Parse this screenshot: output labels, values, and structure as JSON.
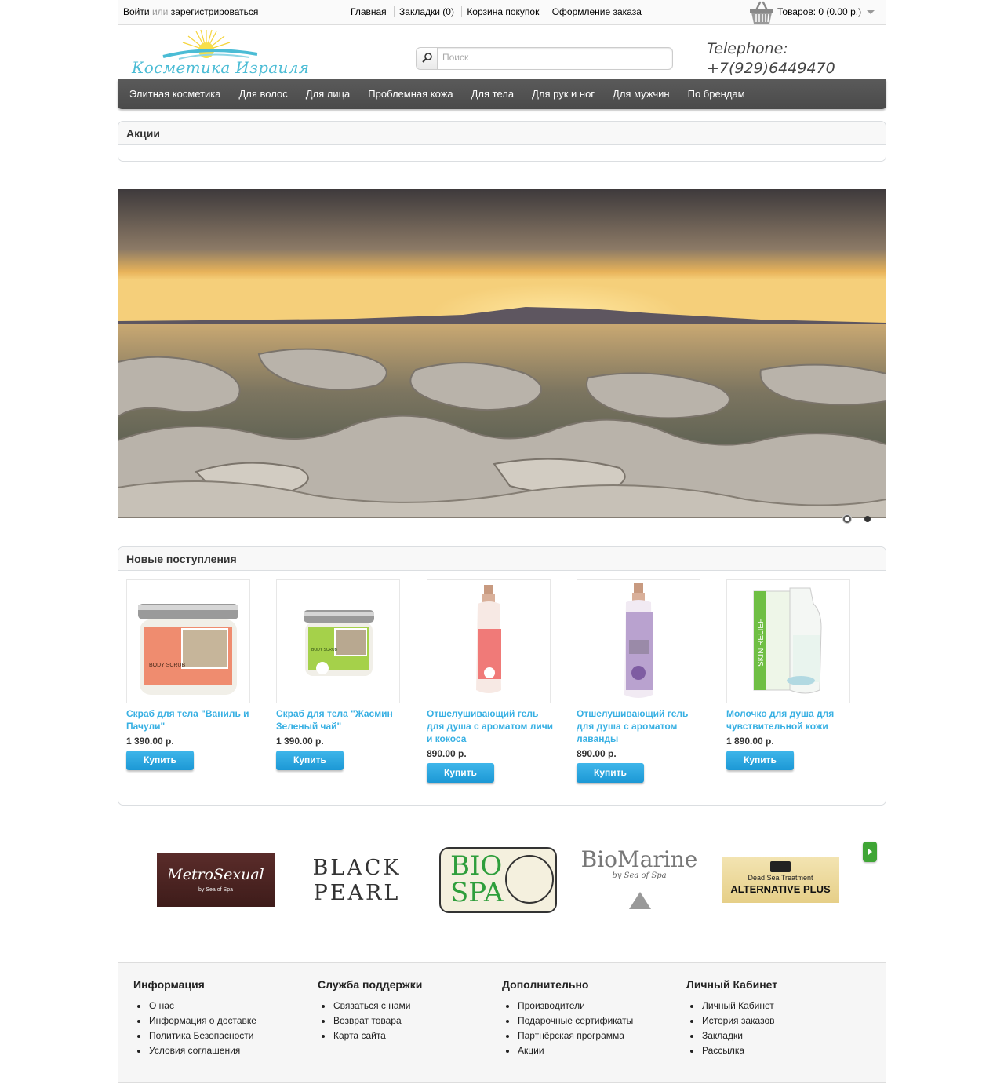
{
  "topbar": {
    "login": "Войти",
    "or": "или",
    "register": "зарегистрироваться",
    "links": [
      "Главная",
      "Закладки (0)",
      "Корзина покупок",
      "Оформление заказа"
    ],
    "cart_text": "Товаров: 0 (0.00 р.)"
  },
  "header": {
    "logo_text": "Косметика Израиля",
    "search_placeholder": "Поиск",
    "phone_label": "Telephone:",
    "phone_number": "+7(929)6449470"
  },
  "menu": {
    "items": [
      "Элитная косметика",
      "Для волос",
      "Для лица",
      "Проблемная кожа",
      "Для тела",
      "Для рук и ног",
      "Для мужчин",
      "По брендам"
    ]
  },
  "promo": {
    "heading": "Акции"
  },
  "slideshow": {
    "active_slide": 1,
    "slide_count": 2
  },
  "new_products": {
    "heading": "Новые поступления",
    "buy_label": "Купить",
    "items": [
      {
        "name": "Скраб для тела \"Ваниль и Пачули\"",
        "price": "1 390.00 р."
      },
      {
        "name": "Скраб для тела \"Жасмин Зеленый чай\"",
        "price": "1 390.00 р."
      },
      {
        "name": "Отшелушивающий гель для душа с ароматом личи и кокоса",
        "price": "890.00 р."
      },
      {
        "name": "Отшелушивающий гель для душа с ароматом лаванды",
        "price": "890.00 р."
      },
      {
        "name": "Молочко для душа для чувствительной кожи",
        "price": "1 890.00 р."
      }
    ]
  },
  "brands": {
    "items": [
      {
        "line1": "MetroSexual",
        "line2": "by Sea of Spa"
      },
      {
        "line1": "BLACK",
        "line2": "PEARL"
      },
      {
        "line1": "BIO",
        "line2": "SPA"
      },
      {
        "line1": "BioMarine",
        "line2": "by Sea of Spa"
      },
      {
        "line1": "Dead Sea Treatment",
        "line2": "ALTERNATIVE PLUS"
      }
    ]
  },
  "footer": {
    "columns": [
      {
        "title": "Информация",
        "links": [
          "О нас",
          "Информация о доставке",
          "Политика Безопасности",
          "Условия соглашения"
        ]
      },
      {
        "title": "Служба поддержки",
        "links": [
          "Связаться с нами",
          "Возврат товара",
          "Карта сайта"
        ]
      },
      {
        "title": "Дополнительно",
        "links": [
          "Производители",
          "Подарочные сертификаты",
          "Партнёрская программа",
          "Акции"
        ]
      },
      {
        "title": "Личный Кабинет",
        "links": [
          "Личный Кабинет",
          "История заказов",
          "Закладки",
          "Рассылка"
        ]
      }
    ]
  }
}
